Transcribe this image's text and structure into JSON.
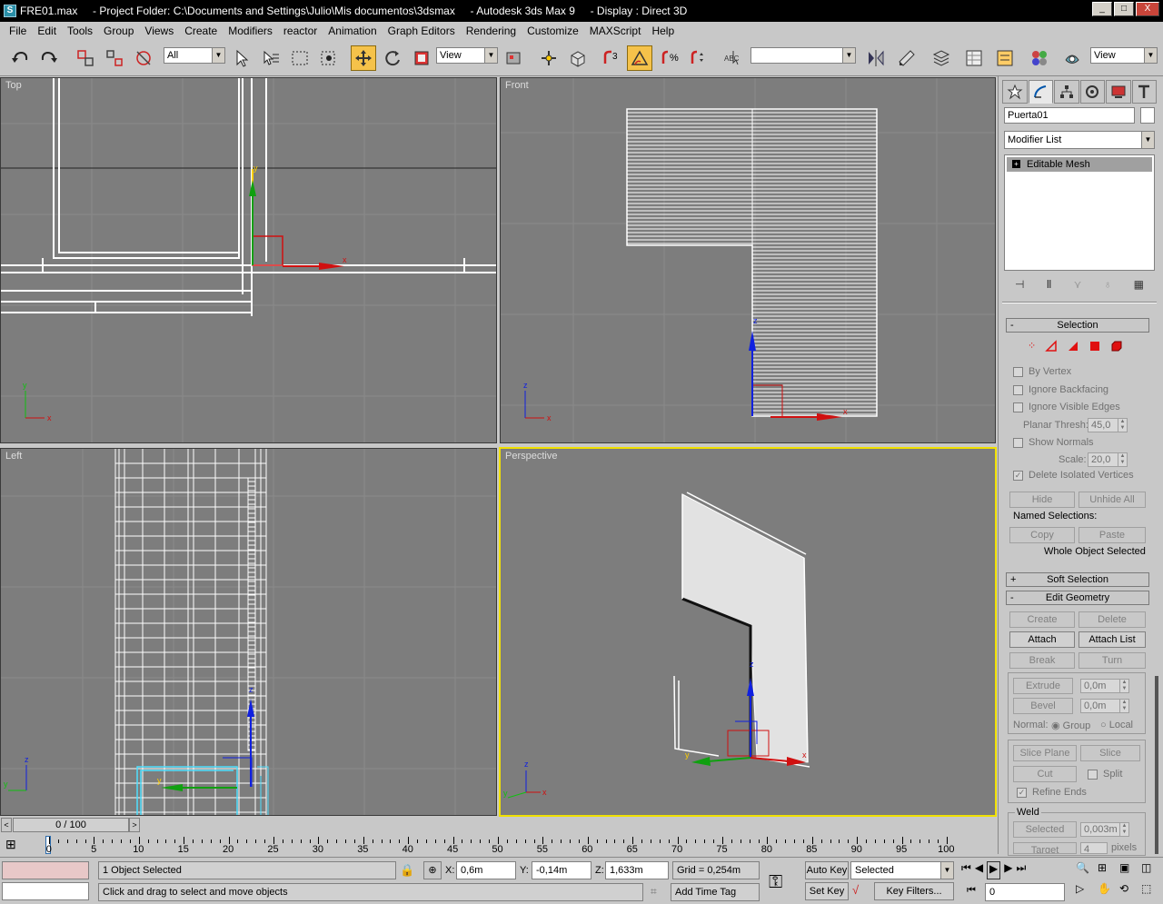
{
  "window": {
    "title": "FRE01.max     - Project Folder: C:\\Documents and Settings\\Julio\\Mis documentos\\3dsmax     - Autodesk 3ds Max 9     - Display : Direct 3D",
    "btn_min": "_",
    "btn_max": "□",
    "btn_close": "X"
  },
  "menu": [
    "File",
    "Edit",
    "Tools",
    "Group",
    "Views",
    "Create",
    "Modifiers",
    "reactor",
    "Animation",
    "Graph Editors",
    "Rendering",
    "Customize",
    "MAXScript",
    "Help"
  ],
  "toolbar": {
    "selection_filter": "All",
    "ref_coord": "View",
    "named_sel": "",
    "right_view": "View",
    "snap_num": "3"
  },
  "viewports": {
    "top": "Top",
    "front": "Front",
    "left": "Left",
    "perspective": "Perspective"
  },
  "command_panel": {
    "object_name": "Puerta01",
    "modifier_list": "Modifier List",
    "stack_item": "Editable Mesh",
    "selection": {
      "header": "Selection",
      "by_vertex": "By Vertex",
      "ignore_backfacing": "Ignore Backfacing",
      "ignore_visible_edges": "Ignore Visible Edges",
      "planar_thresh_label": "Planar Thresh:",
      "planar_thresh_value": "45,0",
      "show_normals": "Show Normals",
      "scale_label": "Scale:",
      "scale_value": "20,0",
      "delete_isolated": "Delete Isolated Vertices",
      "hide": "Hide",
      "unhide_all": "Unhide All",
      "named_selections": "Named Selections:",
      "copy": "Copy",
      "paste": "Paste",
      "whole_object": "Whole Object Selected"
    },
    "soft_selection": "Soft Selection",
    "edit_geometry": {
      "header": "Edit Geometry",
      "create": "Create",
      "delete": "Delete",
      "attach": "Attach",
      "attach_list": "Attach List",
      "break": "Break",
      "turn": "Turn",
      "extrude": "Extrude",
      "extrude_value": "0,0m",
      "bevel": "Bevel",
      "bevel_value": "0,0m",
      "normal_label": "Normal:",
      "group": "Group",
      "local": "Local",
      "slice_plane": "Slice Plane",
      "slice": "Slice",
      "cut": "Cut",
      "split": "Split",
      "refine_ends": "Refine Ends",
      "weld": "Weld",
      "selected": "Selected",
      "weld_value": "0,003m",
      "target": "Target",
      "target_value": "4",
      "pixels": "pixels"
    }
  },
  "timeline": {
    "slider": "0 / 100",
    "ticks": [
      "0",
      "5",
      "10",
      "15",
      "20",
      "25",
      "30",
      "35",
      "40",
      "45",
      "50",
      "55",
      "60",
      "65",
      "70",
      "75",
      "80",
      "85",
      "90",
      "95",
      "100"
    ]
  },
  "status": {
    "selection": "1 Object Selected",
    "prompt": "Click and drag to select and move objects",
    "x_label": "X:",
    "x_value": "0,6m",
    "y_label": "Y:",
    "y_value": "-0,14m",
    "z_label": "Z:",
    "z_value": "1,633m",
    "grid": "Grid = 0,254m",
    "add_time_tag": "Add Time Tag",
    "auto_key": "Auto Key",
    "set_key": "Set Key",
    "key_mode": "Selected",
    "key_filters": "Key Filters...",
    "frame": "0"
  },
  "colors": {
    "viewport_bg": "#7d7d7d",
    "active_viewport_border": "#f0e000",
    "axis_x": "#d01010",
    "axis_y": "#10c010",
    "axis_z": "#1020e0"
  }
}
